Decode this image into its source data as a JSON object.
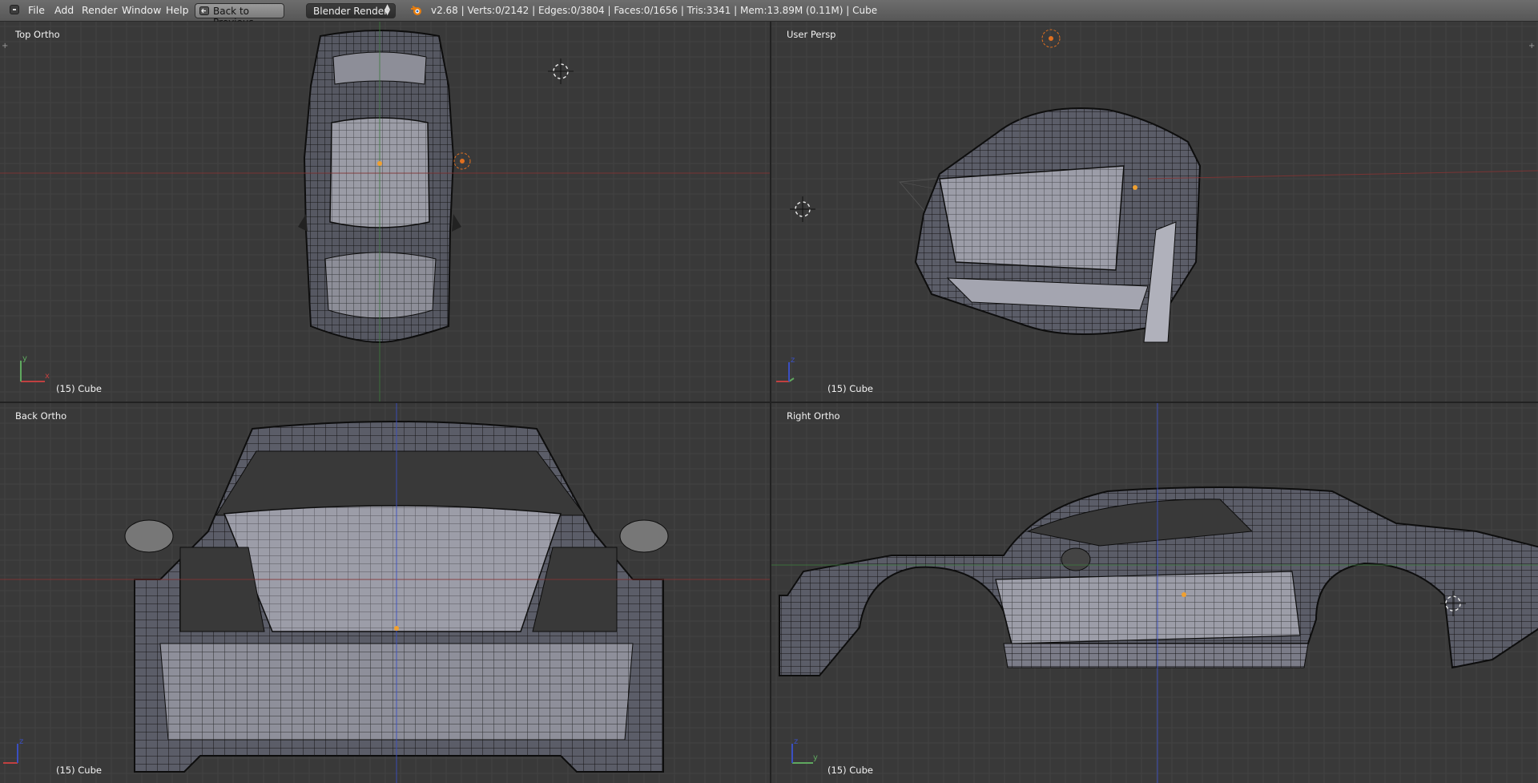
{
  "menu": {
    "items": [
      "File",
      "Add",
      "Render",
      "Window",
      "Help"
    ],
    "back_label": "Back to Previous",
    "engine": "Blender Render",
    "stats": "v2.68 | Verts:0/2142 | Edges:0/3804 | Faces:0/1656 | Tris:3341 | Mem:13.89M (0.11M) | Cube"
  },
  "viewports": {
    "top": {
      "name": "Top Ortho",
      "object": "(15) Cube"
    },
    "persp": {
      "name": "User Persp",
      "object": "(15) Cube"
    },
    "back": {
      "name": "Back Ortho",
      "object": "(15) Cube"
    },
    "right": {
      "name": "Right Ortho",
      "object": "(15) Cube"
    }
  },
  "axes": {
    "x": "x",
    "y": "y",
    "z": "z"
  },
  "colors": {
    "x_axis": "#b03a3a",
    "y_axis": "#5fa85f",
    "z_axis": "#3a4fc2",
    "mesh_fill": "#8e8e9a",
    "wire": "#0d0d0d",
    "cursor": "#d8d8d8"
  }
}
